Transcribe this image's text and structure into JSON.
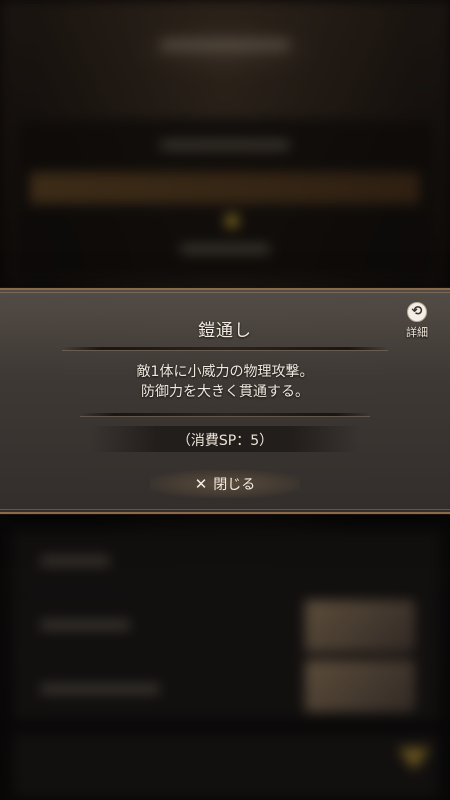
{
  "dialog": {
    "skill_name": "鎧通し",
    "detail_label": "詳細",
    "description_lines": [
      "敵1体に小威力の物理攻撃。",
      "防御力を大きく貫通する。"
    ],
    "sp_cost_text": "（消費SP：5）",
    "close_label": "閉じる"
  },
  "icons": {
    "detail": "refresh-swap-icon",
    "close": "x-icon"
  },
  "colors": {
    "panel": "#3f3935",
    "border_accent": "#8a6a4a",
    "text": "#efe8de"
  }
}
